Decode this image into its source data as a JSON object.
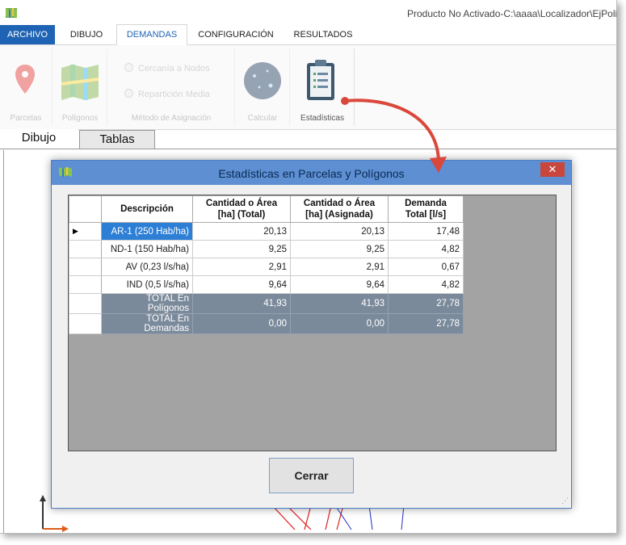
{
  "titlebar": {
    "title": "Producto No Activado-C:\\aaaa\\Localizador\\EjPolig",
    "icon": "map-icon"
  },
  "ribbon_tabs": [
    "ARCHIVO",
    "DIBUJO",
    "DEMANDAS",
    "CONFIGURACIÓN",
    "RESULTADOS"
  ],
  "ribbon": {
    "parcelas": "Parcelas",
    "poligonos": "Polígonos",
    "radio1": "Cercanía a Nodos",
    "radio2": "Repartición Media",
    "metodo": "Método de Asignación",
    "calcular": "Calcular",
    "estadisticas": "Estadísticas"
  },
  "doc_tabs": [
    "Dibujo",
    "Tablas"
  ],
  "dialog": {
    "title": "Estadísticas en Parcelas y Polígonos",
    "close_glyph": "✕",
    "headers": [
      "Descripción",
      "Cantidad o Área",
      "[ha] (Total)",
      "Cantidad o Área",
      "[ha] (Asignada)",
      "Demanda",
      "Total [l/s]"
    ],
    "rows": [
      {
        "desc": "AR-1 (250 Hab/ha)",
        "total": "20,13",
        "asignada": "20,13",
        "demanda": "17,48"
      },
      {
        "desc": "ND-1 (150 Hab/ha)",
        "total": "9,25",
        "asignada": "9,25",
        "demanda": "4,82"
      },
      {
        "desc": "AV (0,23 l/s/ha)",
        "total": "2,91",
        "asignada": "2,91",
        "demanda": "0,67"
      },
      {
        "desc": "IND (0,5 l/s/ha)",
        "total": "9,64",
        "asignada": "9,64",
        "demanda": "4,82"
      },
      {
        "desc": "TOTAL En Polígonos",
        "total": "41,93",
        "asignada": "41,93",
        "demanda": "27,78"
      },
      {
        "desc": "TOTAL En Demandas",
        "total": "0,00",
        "asignada": "0,00",
        "demanda": "27,78"
      }
    ],
    "row_indicator": "▶",
    "button": "Cerrar"
  },
  "colors": {
    "accent": "#1e63b4",
    "dialog_title": "#5d8fd2",
    "selected": "#2d7fd6",
    "total_row": "#7b8a9b",
    "arrow": "#d9483b"
  }
}
